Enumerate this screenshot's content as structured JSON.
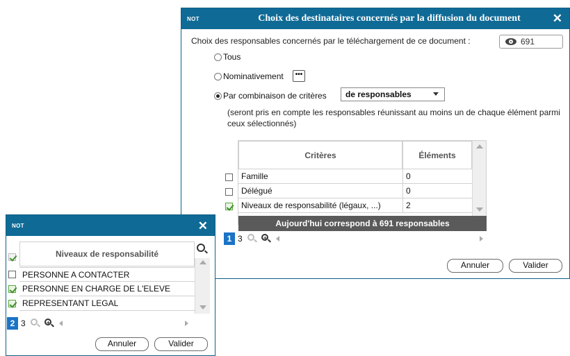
{
  "main_dialog": {
    "tag": "NOT",
    "title": "Choix des destinataires concernés par la diffusion du document",
    "close": "✕",
    "intro": "Choix des responsables concernés par le téléchargement de ce document :",
    "count": "691",
    "options": {
      "tous": "Tous",
      "nominativement": "Nominativement",
      "dots": "•••",
      "par_combinaison": "Par combinaison de critères"
    },
    "combo_value": "de responsables",
    "note": "(seront pris en compte les responsables réunissant au moins un de chaque élément parmi ceux sélectionnés)",
    "table": {
      "headers": {
        "criteres": "Critères",
        "elements": "Éléments"
      },
      "rows": [
        {
          "label": "Famille",
          "value": "0",
          "checked": false
        },
        {
          "label": "Délégué",
          "value": "0",
          "checked": false
        },
        {
          "label": "Niveaux de responsabilité (légaux, ...)",
          "value": "2",
          "checked": true
        }
      ],
      "footer": "Aujourd'hui correspond à 691 responsables",
      "page": "1",
      "pages": "3"
    },
    "buttons": {
      "cancel": "Annuler",
      "validate": "Valider"
    }
  },
  "sub_dialog": {
    "tag": "NOT",
    "close": "✕",
    "header": "Niveaux de responsabilité",
    "items": [
      {
        "label": "PERSONNE A CONTACTER",
        "checked": false
      },
      {
        "label": "PERSONNE EN CHARGE DE L'ELEVE",
        "checked": true
      },
      {
        "label": "REPRESENTANT LEGAL",
        "checked": true
      }
    ],
    "page": "2",
    "pages": "3",
    "buttons": {
      "cancel": "Annuler",
      "validate": "Valider"
    }
  },
  "colors": {
    "titlebar": "#0f6a96",
    "footer": "#5a5a5a",
    "page_badge": "#1a73c7",
    "check": "#58a83a"
  }
}
